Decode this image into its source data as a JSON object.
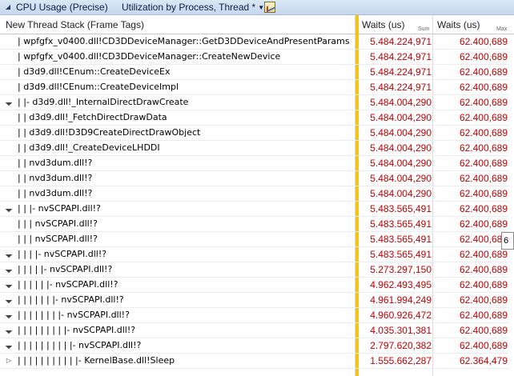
{
  "toolbar": {
    "collapse_icon": "collapse-triangle-icon",
    "title": "CPU Usage (Precise)",
    "preset": "Utilization by Process, Thread *",
    "dropdown_icon": "dropdown-arrow-icon",
    "chart_icon": "graph-view-icon"
  },
  "columns": {
    "stack": "New Thread Stack (Frame Tags)",
    "waits_sum": "Waits (us)",
    "waits_sum_sub": "Sum",
    "waits_max": "Waits (us)",
    "waits_max_sub": "Max"
  },
  "rows": [
    {
      "indent": 2,
      "expander": "",
      "stack": "|   wpfgfx_v0400.dll!CD3DDeviceManager::GetD3DDeviceAndPresentParams",
      "sum": "5.484.224,971",
      "max": "62.400,689"
    },
    {
      "indent": 2,
      "expander": "",
      "stack": "|   wpfgfx_v0400.dll!CD3DDeviceManager::CreateNewDevice",
      "sum": "5.484.224,971",
      "max": "62.400,689"
    },
    {
      "indent": 2,
      "expander": "",
      "stack": "|   d3d9.dll!CEnum::CreateDeviceEx",
      "sum": "5.484.224,971",
      "max": "62.400,689"
    },
    {
      "indent": 2,
      "expander": "",
      "stack": "|   d3d9.dll!CEnum::CreateDeviceImpl",
      "sum": "5.484.224,971",
      "max": "62.400,689"
    },
    {
      "indent": 2,
      "expander": "expanded",
      "stack": "|   |- d3d9.dll!_InternalDirectDrawCreate",
      "sum": "5.484.004,290",
      "max": "62.400,689"
    },
    {
      "indent": 2,
      "expander": "",
      "stack": "|   |      d3d9.dll!_FetchDirectDrawData",
      "sum": "5.484.004,290",
      "max": "62.400,689"
    },
    {
      "indent": 2,
      "expander": "",
      "stack": "|   |      d3d9.dll!D3D9CreateDirectDrawObject",
      "sum": "5.484.004,290",
      "max": "62.400,689"
    },
    {
      "indent": 2,
      "expander": "",
      "stack": "|   |      d3d9.dll!_CreateDeviceLHDDI",
      "sum": "5.484.004,290",
      "max": "62.400,689"
    },
    {
      "indent": 2,
      "expander": "",
      "stack": "|   |      nvd3dum.dll!?",
      "sum": "5.484.004,290",
      "max": "62.400,689"
    },
    {
      "indent": 2,
      "expander": "",
      "stack": "|   |      nvd3dum.dll!?",
      "sum": "5.484.004,290",
      "max": "62.400,689"
    },
    {
      "indent": 2,
      "expander": "",
      "stack": "|   |      nvd3dum.dll!?",
      "sum": "5.484.004,290",
      "max": "62.400,689"
    },
    {
      "indent": 2,
      "expander": "expanded",
      "stack": "|   |   |- nvSCPAPI.dll!?",
      "sum": "5.483.565,491",
      "max": "62.400,689"
    },
    {
      "indent": 2,
      "expander": "",
      "stack": "|   |   |      nvSCPAPI.dll!?",
      "sum": "5.483.565,491",
      "max": "62.400,689"
    },
    {
      "indent": 2,
      "expander": "",
      "stack": "|   |   |      nvSCPAPI.dll!?",
      "sum": "5.483.565,491",
      "max": "62.400,689"
    },
    {
      "indent": 2,
      "expander": "expanded",
      "stack": "|   |   |   |- nvSCPAPI.dll!?",
      "sum": "5.483.565,491",
      "max": "62.400,689"
    },
    {
      "indent": 2,
      "expander": "expanded",
      "stack": "|   |   |   |   |- nvSCPAPI.dll!?",
      "sum": "5.273.297,150",
      "max": "62.400,689"
    },
    {
      "indent": 2,
      "expander": "expanded",
      "stack": "|   |   |   |   |   |- nvSCPAPI.dll!?",
      "sum": "4.962.493,495",
      "max": "62.400,689"
    },
    {
      "indent": 2,
      "expander": "expanded",
      "stack": "|   |   |   |   |   |   |- nvSCPAPI.dll!?",
      "sum": "4.961.994,249",
      "max": "62.400,689"
    },
    {
      "indent": 2,
      "expander": "expanded",
      "stack": "|   |   |   |   |   |   |   |- nvSCPAPI.dll!?",
      "sum": "4.960.926,472",
      "max": "62.400,689"
    },
    {
      "indent": 2,
      "expander": "expanded",
      "stack": "|   |   |   |   |   |   |   |   |- nvSCPAPI.dll!?",
      "sum": "4.035.301,381",
      "max": "62.400,689"
    },
    {
      "indent": 2,
      "expander": "expanded",
      "stack": "|   |   |   |   |   |   |   |   |   |- nvSCPAPI.dll!?",
      "sum": "2.797.620,382",
      "max": "62.400,689"
    },
    {
      "indent": 2,
      "expander": "collapsed",
      "stack": "|   |   |   |   |   |   |   |   |   |   |- KernelBase.dll!Sleep",
      "sum": "1.555.662,287",
      "max": "62.364,479"
    }
  ],
  "tooltip": {
    "text": "6"
  }
}
